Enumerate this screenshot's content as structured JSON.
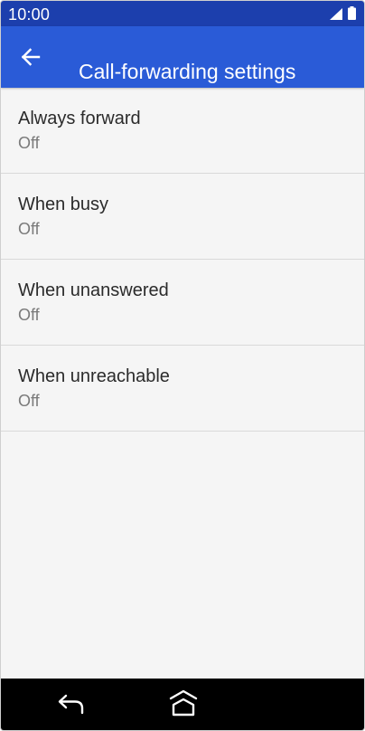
{
  "status_bar": {
    "time": "10:00",
    "icons": [
      "signal-icon",
      "battery-icon"
    ]
  },
  "app_bar": {
    "title": "Call-forwarding settings",
    "back_icon": "arrow-left-icon"
  },
  "settings": {
    "items": [
      {
        "title": "Always forward",
        "summary": "Off"
      },
      {
        "title": "When busy",
        "summary": "Off"
      },
      {
        "title": "When unanswered",
        "summary": "Off"
      },
      {
        "title": "When unreachable",
        "summary": "Off"
      }
    ]
  },
  "nav_bar": {
    "icons": [
      "back-icon",
      "home-icon"
    ]
  },
  "colors": {
    "status_bar": "#1c3fad",
    "app_bar": "#2a5bd7",
    "background": "#f5f5f5",
    "nav_bar": "#000000"
  }
}
